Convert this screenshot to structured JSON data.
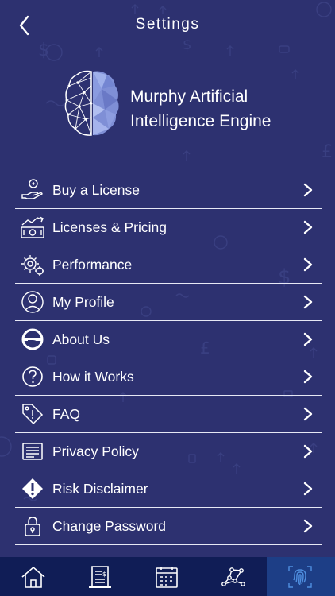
{
  "header": {
    "title": "Settings"
  },
  "brand": {
    "name_line1": "Murphy Artificial",
    "name_line2": "Intelligence Engine"
  },
  "menu": {
    "items": [
      {
        "label": "Buy a License",
        "icon": "hand-coin-icon"
      },
      {
        "label": "Licenses & Pricing",
        "icon": "money-chart-icon"
      },
      {
        "label": "Performance",
        "icon": "gears-icon"
      },
      {
        "label": "My Profile",
        "icon": "user-icon"
      },
      {
        "label": "About Us",
        "icon": "brand-s-icon"
      },
      {
        "label": "How it Works",
        "icon": "question-icon"
      },
      {
        "label": "FAQ",
        "icon": "faq-tag-icon"
      },
      {
        "label": "Privacy Policy",
        "icon": "document-list-icon"
      },
      {
        "label": "Risk Disclaimer",
        "icon": "warning-icon"
      },
      {
        "label": "Change Password",
        "icon": "lock-icon"
      }
    ]
  },
  "tabbar": {
    "tabs": [
      "home-icon",
      "receipt-icon",
      "calendar-icon",
      "network-icon",
      "fingerprint-icon"
    ],
    "active": "fingerprint-icon"
  },
  "colors": {
    "background": "#2d3170",
    "tabbar": "#101d56",
    "tab_active": "#1d3e86",
    "divider": "#e7e8f5"
  }
}
